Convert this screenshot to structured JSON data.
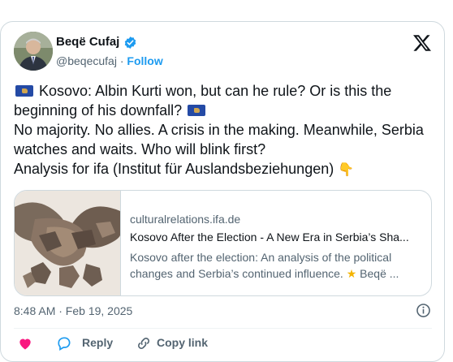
{
  "author": {
    "name": "Beqë Cufaj",
    "handle": "@beqecufaj",
    "separator": "·",
    "follow_label": "Follow"
  },
  "tweet": {
    "line1": "Kosovo: Albin Kurti won, but can he rule? Or is this the beginning of his downfall?",
    "line2": "No majority. No allies. A crisis in the making. Meanwhile, Serbia watches and waits. Who will blink first?",
    "line3": "Analysis for ifa (Institut für Auslandsbeziehungen)"
  },
  "link_card": {
    "domain": "culturalrelations.ifa.de",
    "title": "Kosovo After the Election - A New Era in Serbia’s Sha...",
    "description_1": "Kosovo after the election: An analysis of the political changes and Serbia’s continued influence.",
    "description_2": "Beqë ..."
  },
  "timestamp": "8:48 AM · Feb 19, 2025",
  "actions": {
    "reply_label": "Reply",
    "share_label": "Copy link"
  },
  "colors": {
    "accent": "#1d9bf0",
    "secondary_text": "#536471",
    "border": "#cfd9de",
    "like": "#f91880"
  }
}
